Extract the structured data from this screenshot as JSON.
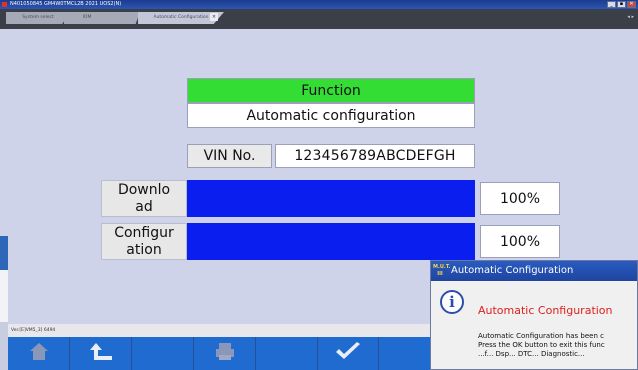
{
  "window": {
    "title": "N401050845 GM4W0TMCL2B 2021 UOS2(N)",
    "controls": [
      "_",
      "▪",
      "✕"
    ]
  },
  "tabs": [
    {
      "label": "System select"
    },
    {
      "label": "IOM"
    },
    {
      "label": ""
    },
    {
      "label": "Automatic Configuration",
      "active": true
    }
  ],
  "tab_close": "×",
  "tab_scroll": "◂ ▸",
  "function": {
    "header": "Function",
    "value": "Automatic configuration",
    "header_color": "#33dd33"
  },
  "vin": {
    "label": "VIN No.",
    "value": "123456789ABCDEFGH"
  },
  "progress": [
    {
      "label_line1": "Downlo",
      "label_line2": "ad",
      "percent_text": "100%",
      "fraction": 1.0,
      "bar_color": "#0a1ef0"
    },
    {
      "label_line1": "Configur",
      "label_line2": "ation",
      "percent_text": "100%",
      "fraction": 1.0,
      "bar_color": "#0a1ef0"
    }
  ],
  "status": {
    "version": "Ver.[E]VM5_3] 6494"
  },
  "toolbar": {
    "icons": [
      "home-icon",
      "back-icon",
      "blank",
      "print-icon",
      "blank",
      "check-icon",
      "blank"
    ]
  },
  "dialog": {
    "title": "Automatic Configuration",
    "logo": "M.U.T.-III",
    "heading": "Automatic Configuration",
    "body_line1": "Automatic Configuration has been c",
    "body_line2": "Press the OK button to exit this func",
    "body_line3": "...f... Dsp... DTC... Diagnostic..."
  }
}
